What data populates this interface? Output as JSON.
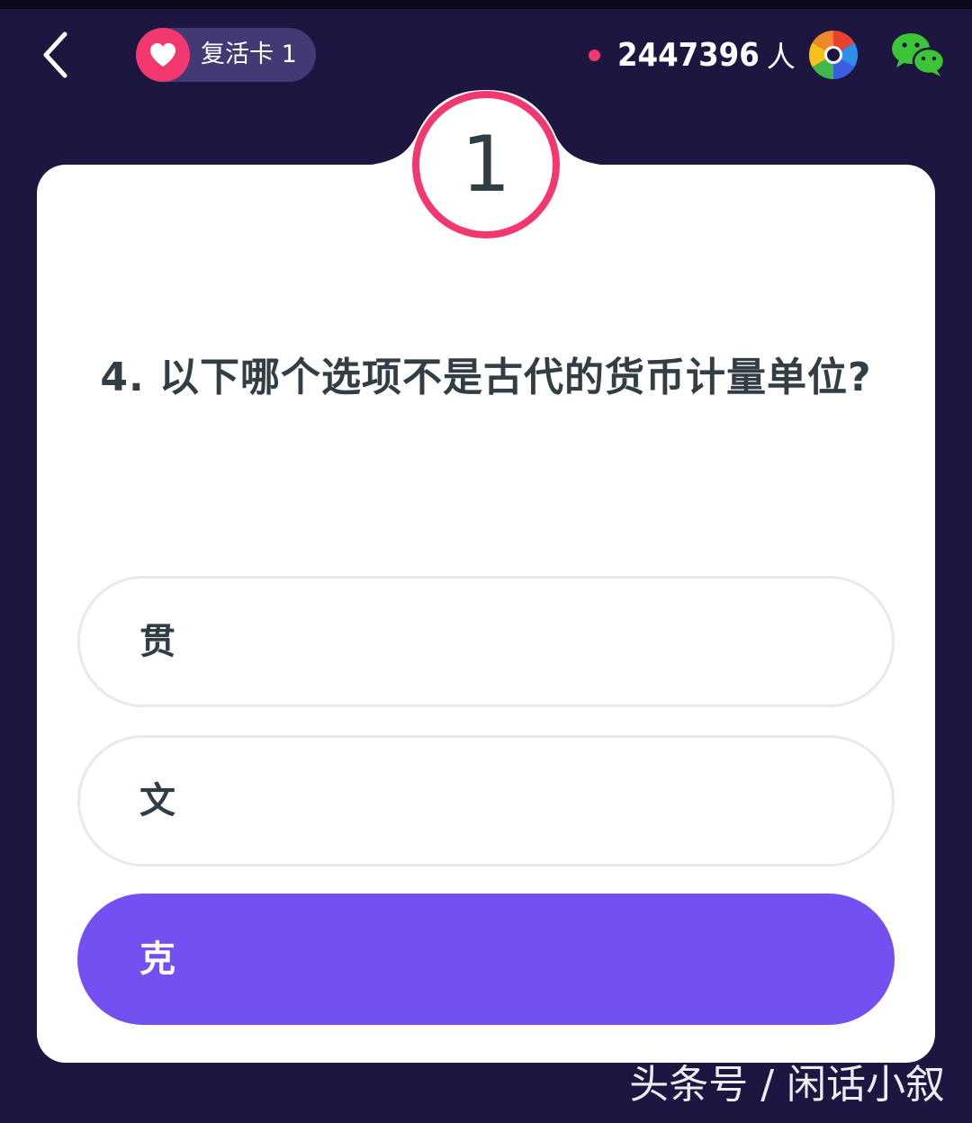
{
  "header": {
    "revive_card_label": "复活卡 1",
    "online_count": "2447396",
    "online_unit": "人"
  },
  "quiz": {
    "countdown": "1",
    "question": "4. 以下哪个选项不是古代的货币计量单位?",
    "options": [
      {
        "label": "贯"
      },
      {
        "label": "文"
      },
      {
        "label": "克"
      }
    ],
    "selected_index": 2
  },
  "watermark": "头条号 / 闲话小叙",
  "colors": {
    "background": "#1d1640",
    "accent_pink": "#f2386e",
    "selected_purple": "#7450f2",
    "wechat_green": "#3bc435"
  }
}
